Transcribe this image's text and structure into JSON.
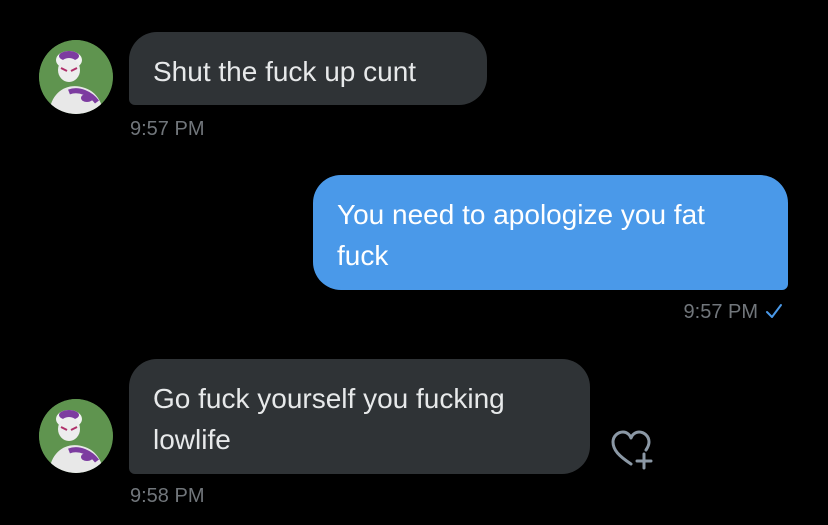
{
  "messages": [
    {
      "direction": "received",
      "text": "Shut the fuck up cunt",
      "time": "9:57 PM"
    },
    {
      "direction": "sent",
      "text": "You need to apologize you fat\nfuck",
      "time": "9:57 PM",
      "status_icon": "checkmark-icon"
    },
    {
      "direction": "received",
      "text": "Go fuck yourself you fucking\nlowlife",
      "time": "9:58 PM",
      "action_icon": "heart-plus-icon"
    }
  ],
  "colors": {
    "background": "#000000",
    "received_bubble": "#2f3336",
    "sent_bubble": "#4a99e9",
    "timestamp": "#71767b",
    "check": "#4a99e9"
  }
}
